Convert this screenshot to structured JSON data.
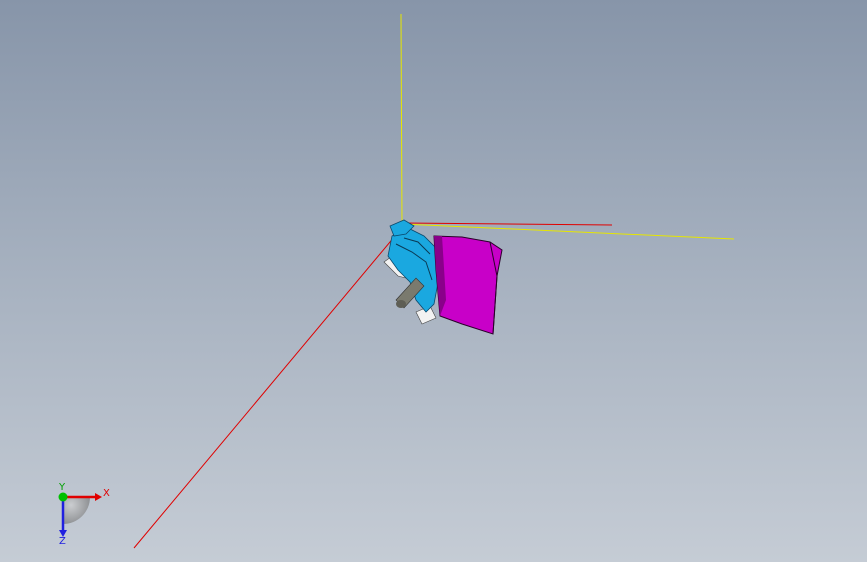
{
  "viewport": {
    "background_top": "#8795a9",
    "background_bottom": "#c5ccd5"
  },
  "model": {
    "body_color": "#c800c8",
    "bracket_color": "#1aa8e0",
    "shaft_color": "#7a7a6e",
    "clip_color": "#f2f2f2"
  },
  "axes": {
    "x_color": "#e00000",
    "y_color": "#e6e600",
    "z_color": "#1a1aff"
  },
  "triad": {
    "x_label": "X",
    "y_label": "Y",
    "z_label": "Z",
    "x_color": "#e00000",
    "y_color": "#00c000",
    "z_color": "#2020e0"
  }
}
